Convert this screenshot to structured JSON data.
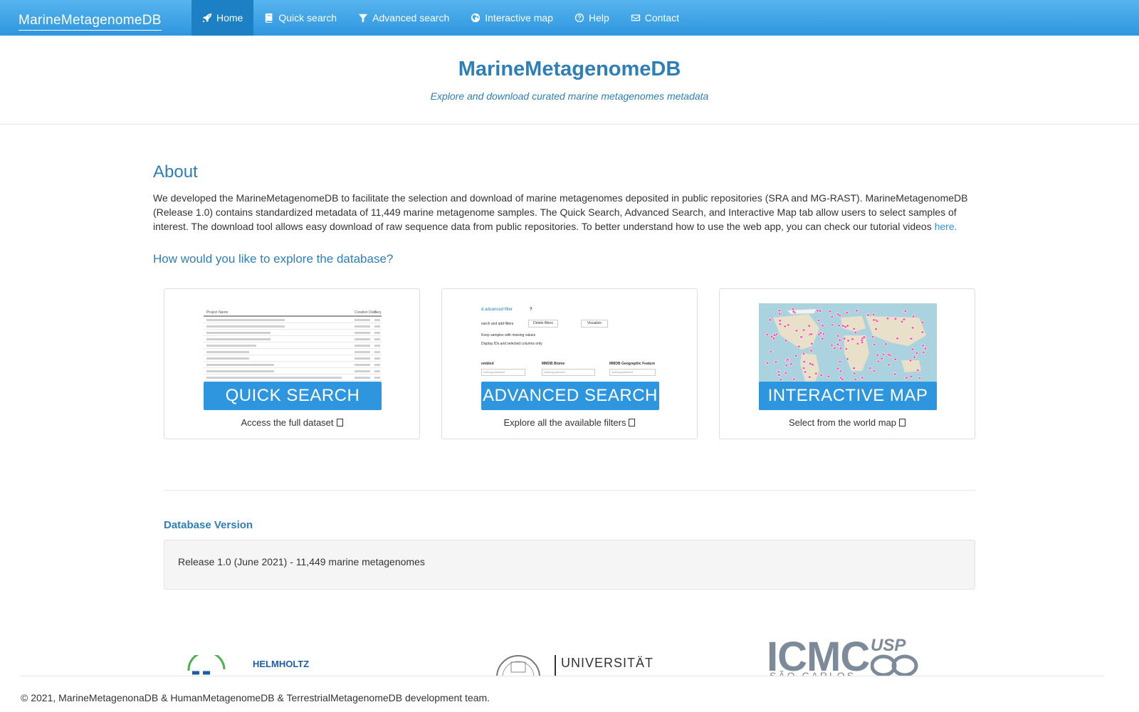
{
  "navbar": {
    "brand": "MarineMetagenomeDB",
    "items": [
      {
        "label": "Home",
        "icon": "rocket-icon",
        "active": true
      },
      {
        "label": "Quick search",
        "icon": "book-icon"
      },
      {
        "label": "Advanced search",
        "icon": "filter-icon"
      },
      {
        "label": "Interactive map",
        "icon": "globe-icon"
      },
      {
        "label": "Help",
        "icon": "question-icon"
      },
      {
        "label": "Contact",
        "icon": "envelope-icon"
      }
    ]
  },
  "hero": {
    "title": "MarineMetagenomeDB",
    "subtitle": "Explore and download curated marine metagenomes metadata"
  },
  "about": {
    "heading": "About",
    "text": "We developed the MarineMetagenomeDB to facilitate the selection and download of marine metagenomes deposited in public repositories (SRA and MG-RAST). MarineMetagenomeDB (Release 1.0) contains standardized metadata of 11,449 marine metagenome samples. The Quick Search, Advanced Search, and Interactive Map tab allow users to select samples of interest. The download tool allows easy download of raw sequence data from public repositories. To better understand how to use the web app, you can check our tutorial videos ",
    "link_text": "here."
  },
  "explore": {
    "heading": "How would you like to explore the database?",
    "cards": [
      {
        "banner": "QUICK SEARCH",
        "caption": "Access the full dataset"
      },
      {
        "banner": "ADVANCED SEARCH",
        "caption": "Explore all the available filters"
      },
      {
        "banner": "INTERACTIVE MAP",
        "caption": "Select from the world map"
      }
    ],
    "advanced_preview": {
      "title": "d advanced filter",
      "help": "?",
      "btn_add": "earch and add filters",
      "btn_delete": "Delete filters",
      "btn_vis": "Visualize",
      "check1": "Keep samples with missing values",
      "check2": "Display IDs and selected columns only",
      "col1": "embled",
      "col2": "MMDB Biome",
      "col3": "MMDB Geographic Feature",
      "select_placeholder": "Nothing selected"
    },
    "quick_preview": {
      "col1": "Project Name",
      "col2": "Creation Date",
      "col3": "Seq"
    }
  },
  "database_version": {
    "heading": "Database Version",
    "text": "Release 1.0 (June 2021) - 11,449 marine metagenomes"
  },
  "logos": {
    "left_text": "HELMHOLTZ",
    "center_text": "UNIVERSITÄT",
    "right_text": "ICMC",
    "right_badge": "USP",
    "right_sub": "SÃO CARLOS"
  },
  "footer": {
    "text": "© 2021, MarineMetagenonaDB & HumanMetagenomeDB & TerrestrialMetagenomeDB development team."
  },
  "colors": {
    "nav_top": "#57b4ee",
    "nav_bottom": "#2e96df",
    "accent": "#2e7fb8",
    "banner": "#2e96df"
  }
}
